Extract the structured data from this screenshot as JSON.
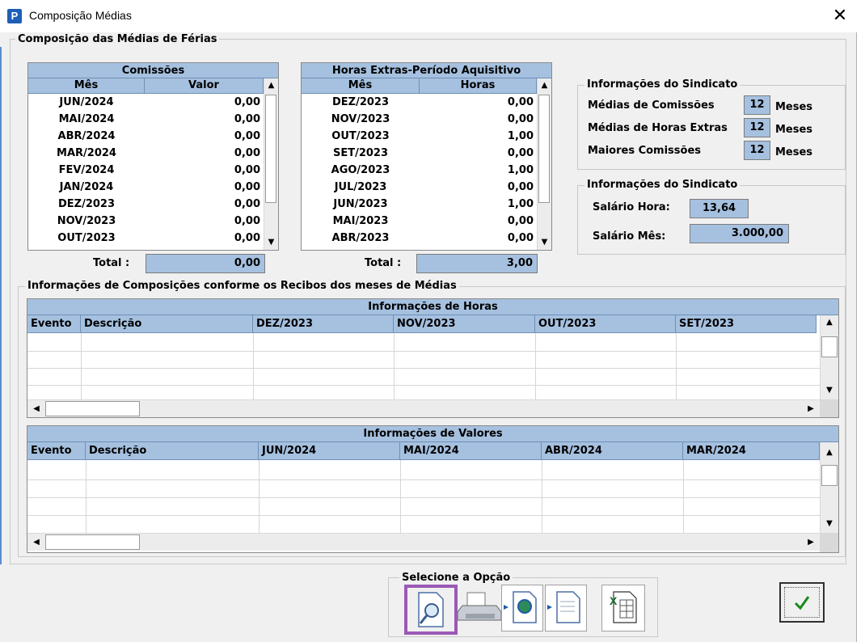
{
  "window": {
    "title": "Composição Médias",
    "app_icon": "P",
    "close_glyph": "✕"
  },
  "main_group": {
    "title": "Composição das Médias de Férias"
  },
  "comissoes": {
    "title": "Comissões",
    "col_mes": "Mês",
    "col_valor": "Valor",
    "rows": [
      [
        "JUN/2024",
        "0,00"
      ],
      [
        "MAI/2024",
        "0,00"
      ],
      [
        "ABR/2024",
        "0,00"
      ],
      [
        "MAR/2024",
        "0,00"
      ],
      [
        "FEV/2024",
        "0,00"
      ],
      [
        "JAN/2024",
        "0,00"
      ],
      [
        "DEZ/2023",
        "0,00"
      ],
      [
        "NOV/2023",
        "0,00"
      ],
      [
        "OUT/2023",
        "0,00"
      ]
    ],
    "total_label": "Total :",
    "total_value": "0,00"
  },
  "horas_extras": {
    "title": "Horas Extras-Período Aquisitivo",
    "col_mes": "Mês",
    "col_horas": "Horas",
    "rows": [
      [
        "DEZ/2023",
        "0,00"
      ],
      [
        "NOV/2023",
        "0,00"
      ],
      [
        "OUT/2023",
        "1,00"
      ],
      [
        "SET/2023",
        "0,00"
      ],
      [
        "AGO/2023",
        "1,00"
      ],
      [
        "JUL/2023",
        "0,00"
      ],
      [
        "JUN/2023",
        "1,00"
      ],
      [
        "MAI/2023",
        "0,00"
      ],
      [
        "ABR/2023",
        "0,00"
      ]
    ],
    "total_label": "Total :",
    "total_value": "3,00"
  },
  "sindicato1": {
    "title": "Informações do Sindicato",
    "rows": [
      {
        "label": "Médias de Comissões",
        "value": "12",
        "unit": "Meses"
      },
      {
        "label": "Médias de Horas Extras",
        "value": "12",
        "unit": "Meses"
      },
      {
        "label": "Maiores Comissões",
        "value": "12",
        "unit": "Meses"
      }
    ]
  },
  "sindicato2": {
    "title": "Informações do Sindicato",
    "salario_hora_label": "Salário Hora:",
    "salario_hora_value": "13,64",
    "salario_mes_label": "Salário Mês:",
    "salario_mes_value": "3.000,00"
  },
  "composicoes": {
    "title": "Informações de Composições conforme os Recibos dos meses de Médias",
    "horas_grid": {
      "band": "Informações de Horas",
      "columns": [
        "Evento",
        "Descrição",
        "DEZ/2023",
        "NOV/2023",
        "OUT/2023",
        "SET/2023"
      ]
    },
    "valores_grid": {
      "band": "Informações de Valores",
      "columns": [
        "Evento",
        "Descrição",
        "JUN/2024",
        "MAI/2024",
        "ABR/2024",
        "MAR/2024"
      ]
    }
  },
  "options": {
    "title": "Selecione a Opção",
    "buttons": [
      "preview-icon",
      "printer-icon",
      "export-web-icon",
      "export-file-icon",
      "excel-icon"
    ],
    "selected_color": "#9b59b6"
  },
  "ok_button": {
    "icon": "checkmark-icon"
  },
  "colors": {
    "header_blue": "#a6c1e0",
    "panel": "#f0f0f0"
  }
}
